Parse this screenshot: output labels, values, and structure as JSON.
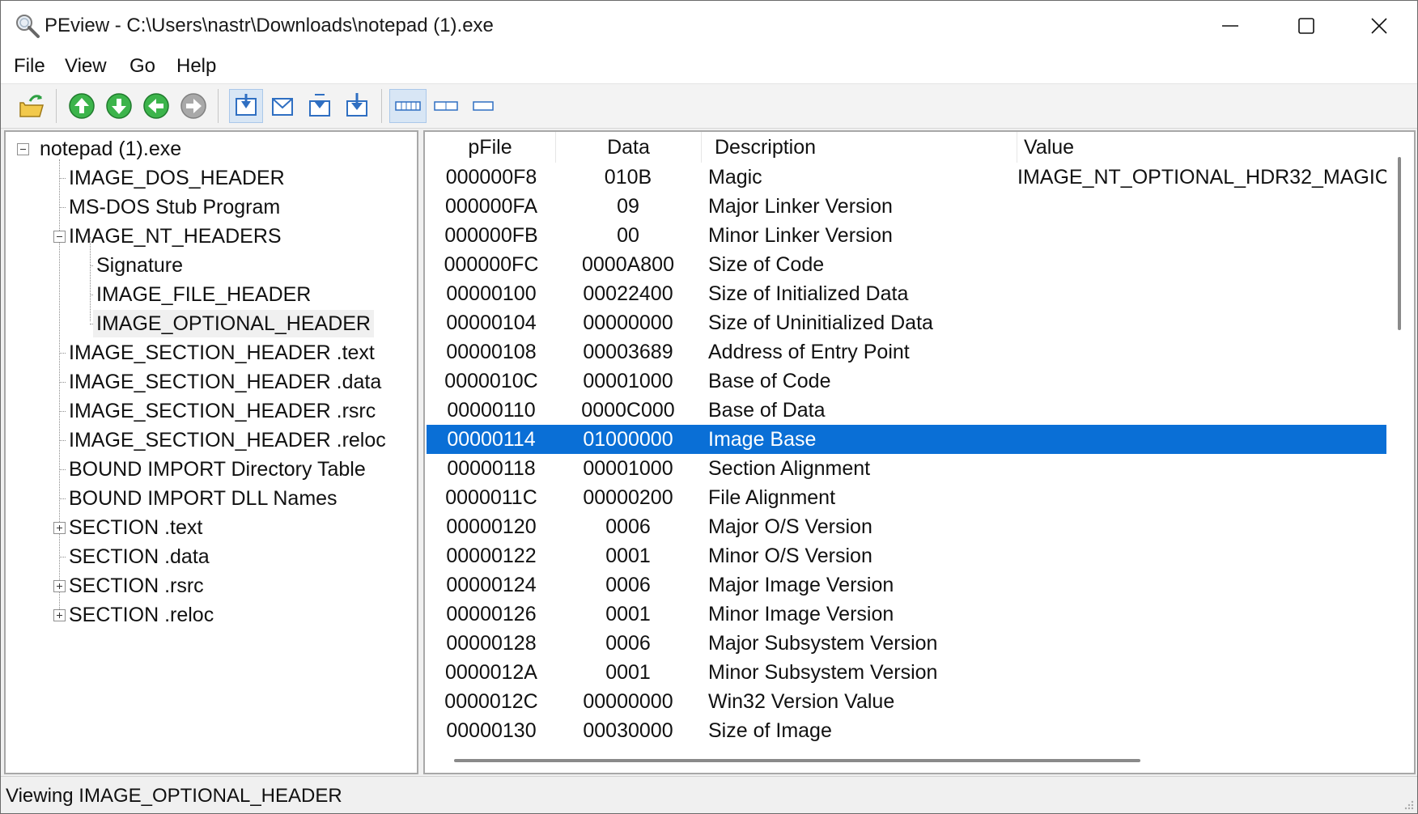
{
  "window": {
    "title": "PEview - C:\\Users\\nastr\\Downloads\\notepad (1).exe"
  },
  "menu": [
    "File",
    "View",
    "Go",
    "Help"
  ],
  "toolbar": {
    "buttons": [
      "open-file",
      "go-up",
      "go-down",
      "go-back",
      "go-forward",
      "view-hex-bytes",
      "view-hex-words",
      "view-hex-dwords",
      "view-details",
      "view-columns-3",
      "view-columns-2",
      "view-columns-1"
    ]
  },
  "tree": {
    "nodes": [
      {
        "label": "notepad (1).exe",
        "level": 0,
        "expander": "minus"
      },
      {
        "label": "IMAGE_DOS_HEADER",
        "level": 1,
        "expander": "none"
      },
      {
        "label": "MS-DOS Stub Program",
        "level": 1,
        "expander": "none"
      },
      {
        "label": "IMAGE_NT_HEADERS",
        "level": 1,
        "expander": "minus"
      },
      {
        "label": "Signature",
        "level": 2,
        "expander": "none"
      },
      {
        "label": "IMAGE_FILE_HEADER",
        "level": 2,
        "expander": "none"
      },
      {
        "label": "IMAGE_OPTIONAL_HEADER",
        "level": 2,
        "expander": "none",
        "selected": true
      },
      {
        "label": "IMAGE_SECTION_HEADER .text",
        "level": 1,
        "expander": "none"
      },
      {
        "label": "IMAGE_SECTION_HEADER .data",
        "level": 1,
        "expander": "none"
      },
      {
        "label": "IMAGE_SECTION_HEADER .rsrc",
        "level": 1,
        "expander": "none"
      },
      {
        "label": "IMAGE_SECTION_HEADER .reloc",
        "level": 1,
        "expander": "none"
      },
      {
        "label": "BOUND IMPORT Directory Table",
        "level": 1,
        "expander": "none"
      },
      {
        "label": "BOUND IMPORT DLL Names",
        "level": 1,
        "expander": "none"
      },
      {
        "label": "SECTION .text",
        "level": 1,
        "expander": "plus"
      },
      {
        "label": "SECTION .data",
        "level": 1,
        "expander": "none"
      },
      {
        "label": "SECTION .rsrc",
        "level": 1,
        "expander": "plus"
      },
      {
        "label": "SECTION .reloc",
        "level": 1,
        "expander": "plus"
      }
    ]
  },
  "list": {
    "columns": [
      "pFile",
      "Data",
      "Description",
      "Value"
    ],
    "rows": [
      {
        "pfile": "000000F8",
        "data": "010B",
        "desc": "Magic",
        "value": "IMAGE_NT_OPTIONAL_HDR32_MAGIC"
      },
      {
        "pfile": "000000FA",
        "data": "09",
        "desc": "Major Linker Version",
        "value": ""
      },
      {
        "pfile": "000000FB",
        "data": "00",
        "desc": "Minor Linker Version",
        "value": ""
      },
      {
        "pfile": "000000FC",
        "data": "0000A800",
        "desc": "Size of Code",
        "value": ""
      },
      {
        "pfile": "00000100",
        "data": "00022400",
        "desc": "Size of Initialized Data",
        "value": ""
      },
      {
        "pfile": "00000104",
        "data": "00000000",
        "desc": "Size of Uninitialized Data",
        "value": ""
      },
      {
        "pfile": "00000108",
        "data": "00003689",
        "desc": "Address of Entry Point",
        "value": ""
      },
      {
        "pfile": "0000010C",
        "data": "00001000",
        "desc": "Base of Code",
        "value": ""
      },
      {
        "pfile": "00000110",
        "data": "0000C000",
        "desc": "Base of Data",
        "value": ""
      },
      {
        "pfile": "00000114",
        "data": "01000000",
        "desc": "Image Base",
        "value": "",
        "selected": true
      },
      {
        "pfile": "00000118",
        "data": "00001000",
        "desc": "Section Alignment",
        "value": ""
      },
      {
        "pfile": "0000011C",
        "data": "00000200",
        "desc": "File Alignment",
        "value": ""
      },
      {
        "pfile": "00000120",
        "data": "0006",
        "desc": "Major O/S Version",
        "value": ""
      },
      {
        "pfile": "00000122",
        "data": "0001",
        "desc": "Minor O/S Version",
        "value": ""
      },
      {
        "pfile": "00000124",
        "data": "0006",
        "desc": "Major Image Version",
        "value": ""
      },
      {
        "pfile": "00000126",
        "data": "0001",
        "desc": "Minor Image Version",
        "value": ""
      },
      {
        "pfile": "00000128",
        "data": "0006",
        "desc": "Major Subsystem Version",
        "value": ""
      },
      {
        "pfile": "0000012A",
        "data": "0001",
        "desc": "Minor Subsystem Version",
        "value": ""
      },
      {
        "pfile": "0000012C",
        "data": "00000000",
        "desc": "Win32 Version Value",
        "value": ""
      },
      {
        "pfile": "00000130",
        "data": "00030000",
        "desc": "Size of Image",
        "value": ""
      }
    ]
  },
  "status": {
    "text": "Viewing IMAGE_OPTIONAL_HEADER"
  },
  "colors": {
    "selection": "#0a6fd6",
    "arrow_green": "#2ea043",
    "toolbar_blue": "#2f6fc2"
  }
}
